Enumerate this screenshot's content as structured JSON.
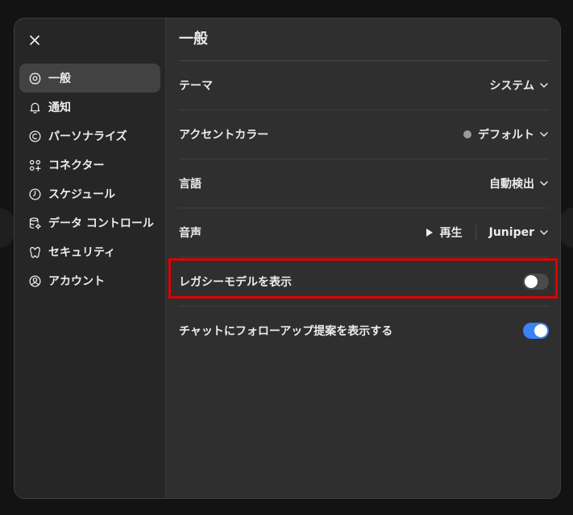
{
  "colors": {
    "highlight": "#e00000",
    "toggle_on": "#3b82f6",
    "toggle_off": "#4b4b4b"
  },
  "sidebar": {
    "close_icon": "close-icon",
    "items": [
      {
        "label": "一般",
        "icon": "gear-icon",
        "active": true
      },
      {
        "label": "通知",
        "icon": "bell-icon"
      },
      {
        "label": "パーソナライズ",
        "icon": "personalize-icon"
      },
      {
        "label": "コネクター",
        "icon": "connectors-icon"
      },
      {
        "label": "スケジュール",
        "icon": "clock-icon"
      },
      {
        "label": "データ コントロール",
        "icon": "database-gear-icon"
      },
      {
        "label": "セキュリティ",
        "icon": "shield-icon"
      },
      {
        "label": "アカウント",
        "icon": "user-circle-icon"
      }
    ]
  },
  "main": {
    "title": "一般",
    "settings": {
      "theme": {
        "label": "テーマ",
        "value": "システム"
      },
      "accent": {
        "label": "アクセントカラー",
        "value": "デフォルト",
        "dot_color": "#9a9a9a"
      },
      "language": {
        "label": "言語",
        "value": "自動検出"
      },
      "voice": {
        "label": "音声",
        "play_label": "再生",
        "value": "Juniper"
      },
      "legacy_models": {
        "label": "レガシーモデルを表示",
        "enabled": false
      },
      "follow_up": {
        "label": "チャットにフォローアップ提案を表示する",
        "enabled": true
      }
    }
  }
}
